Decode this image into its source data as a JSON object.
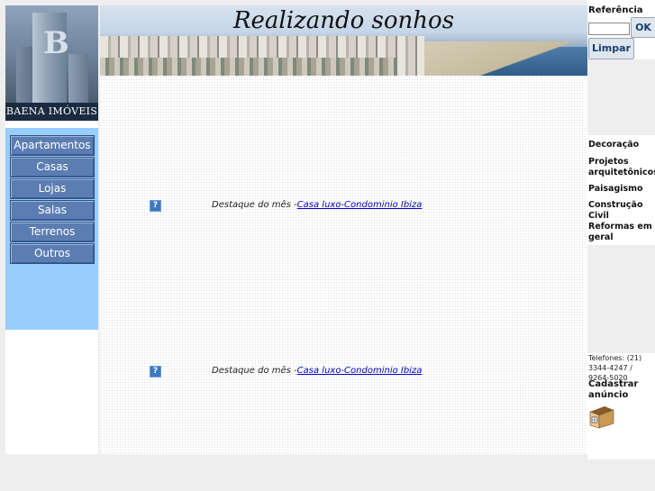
{
  "logo": {
    "brand_text": "BAENA IMÓVEIS",
    "letter": "B"
  },
  "menu": {
    "items": [
      {
        "label": "Apartamentos"
      },
      {
        "label": "Casas"
      },
      {
        "label": "Lojas"
      },
      {
        "label": "Salas"
      },
      {
        "label": "Terrenos"
      },
      {
        "label": "Outros"
      }
    ]
  },
  "banner": {
    "title": "Realizando sonhos"
  },
  "features": [
    {
      "icon": "?",
      "prefix": "Destaque do mês -",
      "link": "Casa luxo-Condominio Ibiza"
    },
    {
      "icon": "?",
      "prefix": "Destaque do mês -",
      "link": "Casa luxo-Condominio Ibiza"
    }
  ],
  "search": {
    "label": "Referência",
    "input_value": "",
    "ok_label": "OK",
    "clear_label": "Limpar"
  },
  "services": [
    {
      "label": "Decoração"
    },
    {
      "label": "Projetos arquitetônicos"
    },
    {
      "label": "Paisagismo"
    },
    {
      "label": "Construção Civil"
    },
    {
      "label": "Reformas em geral"
    }
  ],
  "contact": {
    "phones": "Telefones: (21) 3344-4247 / 9264-5020",
    "register_label": "Cadastrar anúncio"
  },
  "colors": {
    "menu_bg": "#99ccff",
    "menu_button": "#5b7db2",
    "link": "#0000cc"
  }
}
